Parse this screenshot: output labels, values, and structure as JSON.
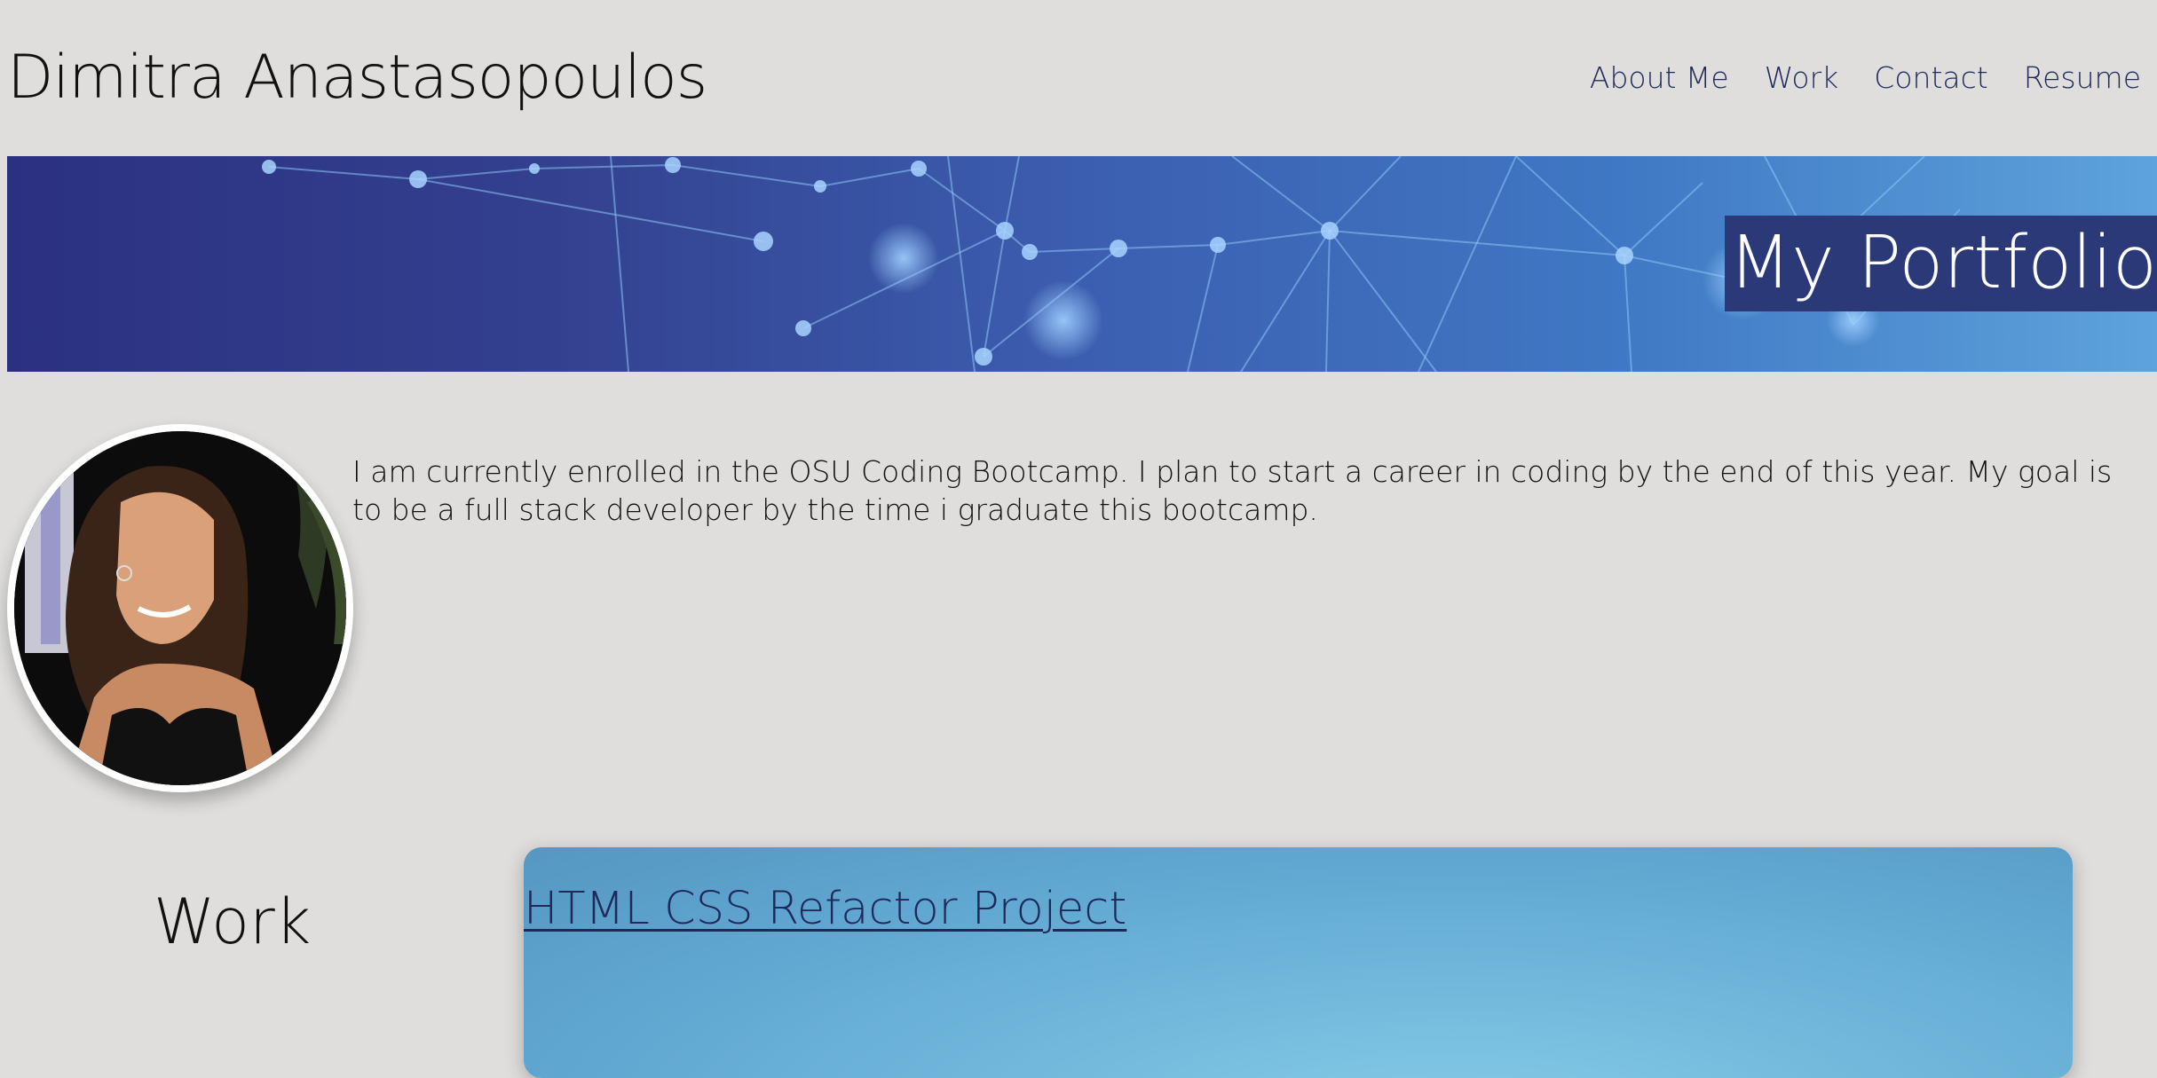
{
  "header": {
    "site_title": "Dimitra Anastasopoulos",
    "nav": [
      {
        "label": "About Me"
      },
      {
        "label": "Work"
      },
      {
        "label": "Contact"
      },
      {
        "label": "Resume"
      }
    ]
  },
  "hero": {
    "title": "My Portfolio"
  },
  "about": {
    "text": "I am currently enrolled in the OSU Coding Bootcamp. I plan to start a career in coding by the end of this year. My goal is to be a full stack developer by the time i graduate this bootcamp."
  },
  "work": {
    "heading": "Work",
    "projects": [
      {
        "title": "HTML CSS Refactor Project"
      }
    ]
  },
  "colors": {
    "page_background": "#dfdedc",
    "link": "#1f2a5a",
    "hero_title_background": "#2b3978",
    "card": "#72b8dc"
  }
}
